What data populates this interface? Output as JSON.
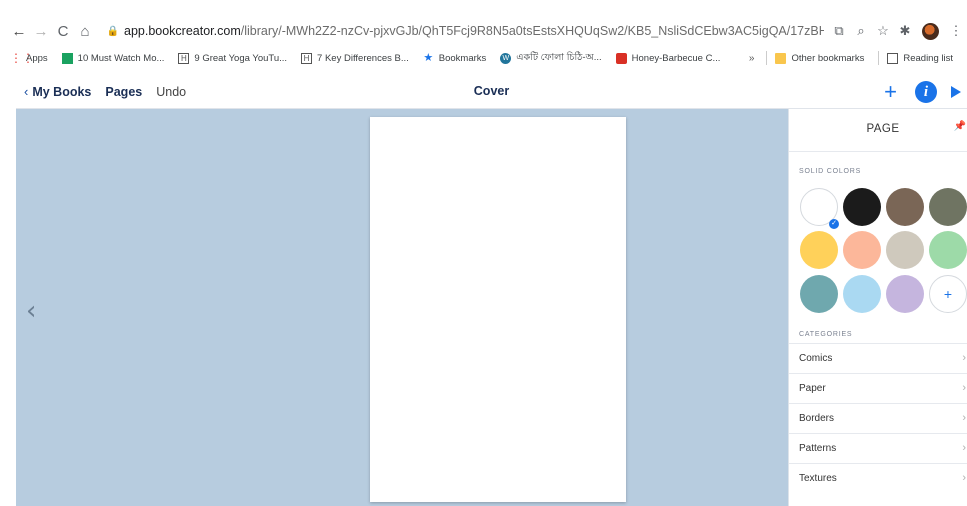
{
  "browser": {
    "url_domain": "app.bookcreator.com",
    "url_path": "/library/-MWh2Z2-nzCv-pjxvGJb/QhT5Fcj9R8N5a0tsEstsXHQUqSw2/KB5_NsliSdCEbw3AC5igQA/17zBHtQhSrCUXA27DZ_d..."
  },
  "bookmarks": {
    "apps": "Apps",
    "items": [
      {
        "label": "10 Must Watch Mo..."
      },
      {
        "label": "9 Great Yoga YouTu..."
      },
      {
        "label": "7 Key Differences B..."
      },
      {
        "label": "Bookmarks"
      },
      {
        "label": "একটি ফোলা চিঠি-অ..."
      },
      {
        "label": "Honey-Barbecue C..."
      }
    ],
    "overflow": "»",
    "other": "Other bookmarks",
    "reading_list": "Reading list"
  },
  "toolbar": {
    "my_books": "My Books",
    "pages": "Pages",
    "undo": "Undo",
    "title": "Cover",
    "add": "+",
    "info": "i"
  },
  "canvas": {
    "prev_page": "‹"
  },
  "panel": {
    "title": "PAGE",
    "solid_colors_label": "SOLID COLORS",
    "swatches": [
      {
        "color": "#ffffff",
        "selected": true
      },
      {
        "color": "#1b1b1b"
      },
      {
        "color": "#7a6656"
      },
      {
        "color": "#6f7462"
      },
      {
        "color": "#ffd15a"
      },
      {
        "color": "#fcb79a"
      },
      {
        "color": "#cfc9bd"
      },
      {
        "color": "#9ddaa8"
      },
      {
        "color": "#6fa8ae"
      },
      {
        "color": "#aad9f2"
      },
      {
        "color": "#c5b5de"
      }
    ],
    "add_color": "+",
    "categories_label": "CATEGORIES",
    "categories": [
      {
        "label": "Comics"
      },
      {
        "label": "Paper"
      },
      {
        "label": "Borders"
      },
      {
        "label": "Patterns"
      },
      {
        "label": "Textures"
      }
    ]
  }
}
